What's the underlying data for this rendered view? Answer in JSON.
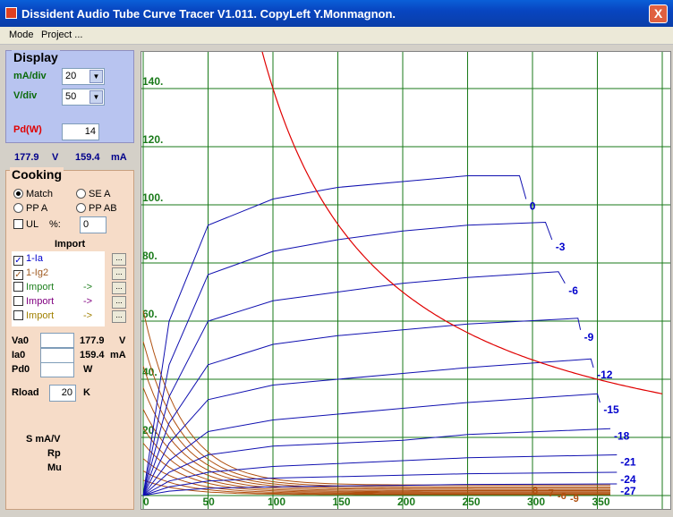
{
  "window": {
    "title": "Dissident Audio Tube Curve Tracer V1.011. CopyLeft Y.Monmagnon.",
    "close": "X"
  },
  "menu": [
    "Mode",
    "Project ..."
  ],
  "display": {
    "title": "Display",
    "ma_div_label": "mA/div",
    "ma_div_value": "20",
    "v_div_label": "V/div",
    "v_div_value": "50",
    "pd_label": "Pd(W)",
    "pd_value": "14"
  },
  "readout": {
    "voltage": "177.9",
    "voltage_unit": "V",
    "current": "159.4",
    "current_unit": "mA"
  },
  "cooking": {
    "title": "Cooking",
    "radios": [
      {
        "label": "Match",
        "checked": true
      },
      {
        "label": "SE A",
        "checked": false
      },
      {
        "label": "PP A",
        "checked": false
      },
      {
        "label": "PP AB",
        "checked": false
      }
    ],
    "ul_label": "UL",
    "ul_pct": "%:",
    "ul_value": "0",
    "import_title": "Import",
    "imports": [
      {
        "label": "1-Ia",
        "checked": true,
        "color": "#0000cc",
        "arrow": ""
      },
      {
        "label": "1-Ig2",
        "checked": true,
        "color": "#a05a20",
        "arrow": ""
      },
      {
        "label": "Import",
        "checked": false,
        "color": "#208020",
        "arrow": "->"
      },
      {
        "label": "Import",
        "checked": false,
        "color": "#800080",
        "arrow": "->"
      },
      {
        "label": "Import",
        "checked": false,
        "color": "#a08000",
        "arrow": "->"
      }
    ],
    "dots": "...",
    "va0_label": "Va0",
    "va0_value": "177.9",
    "va0_unit": "V",
    "ia0_label": "Ia0",
    "ia0_value": "159.4",
    "ia0_unit": "mA",
    "pd0_label": "Pd0",
    "pd0_value": "",
    "pd0_unit": "W",
    "rload_label": "Rload",
    "rload_value": "20",
    "rload_unit": "K",
    "s_label": "S mA/V",
    "rp_label": "Rp",
    "mu_label": "Mu"
  },
  "chart_data": {
    "type": "line",
    "xlabel": "",
    "ylabel": "",
    "xlim": [
      0,
      400
    ],
    "ylim": [
      0,
      160
    ],
    "x_ticks": [
      "0",
      "50",
      "100",
      "150",
      "200",
      "250",
      "300",
      "350"
    ],
    "y_ticks": [
      "20.",
      "40.",
      "60.",
      "80.",
      "100.",
      "120.",
      "140."
    ],
    "grid": true,
    "colors": {
      "plate": "#1010b0",
      "screen": "#b05010",
      "power": "#e00000",
      "grid": "#1a7a1a",
      "label": "#0000cc"
    },
    "series": [
      {
        "name": "0",
        "x": [
          0,
          20,
          50,
          100,
          150,
          200,
          250,
          290,
          295
        ],
        "y": [
          0,
          60,
          93,
          102,
          106,
          108,
          110,
          110,
          102
        ]
      },
      {
        "name": "-3",
        "x": [
          0,
          20,
          50,
          100,
          150,
          200,
          250,
          310,
          315
        ],
        "y": [
          0,
          45,
          76,
          84,
          88,
          91,
          93,
          94,
          88
        ]
      },
      {
        "name": "-6",
        "x": [
          0,
          20,
          50,
          100,
          150,
          200,
          250,
          320,
          325
        ],
        "y": [
          0,
          34,
          60,
          67,
          70,
          73,
          75,
          77,
          73
        ]
      },
      {
        "name": "-9",
        "x": [
          0,
          20,
          50,
          100,
          150,
          200,
          250,
          335,
          337
        ],
        "y": [
          0,
          25,
          45,
          52,
          55,
          57,
          59,
          61,
          57
        ]
      },
      {
        "name": "-12",
        "x": [
          0,
          20,
          50,
          100,
          150,
          200,
          250,
          345,
          347
        ],
        "y": [
          0,
          18,
          33,
          38,
          40,
          42,
          44,
          47,
          44
        ]
      },
      {
        "name": "-15",
        "x": [
          0,
          20,
          50,
          100,
          150,
          200,
          250,
          350,
          352
        ],
        "y": [
          0,
          12,
          22,
          26,
          28,
          30,
          32,
          35,
          32
        ]
      },
      {
        "name": "-18",
        "x": [
          0,
          20,
          50,
          100,
          150,
          200,
          250,
          360
        ],
        "y": [
          0,
          8,
          14,
          17,
          18,
          19,
          21,
          23
        ]
      },
      {
        "name": "-21",
        "x": [
          0,
          20,
          50,
          100,
          150,
          200,
          250,
          365
        ],
        "y": [
          0,
          5,
          8,
          10,
          11,
          12,
          13,
          14
        ]
      },
      {
        "name": "-24",
        "x": [
          0,
          20,
          50,
          100,
          150,
          200,
          250,
          365
        ],
        "y": [
          0,
          3,
          5,
          6,
          6.5,
          7,
          7.5,
          8
        ]
      },
      {
        "name": "-27",
        "x": [
          0,
          20,
          50,
          100,
          150,
          200,
          250,
          365
        ],
        "y": [
          0,
          1.5,
          2.5,
          3,
          3.3,
          3.5,
          3.8,
          4
        ]
      }
    ],
    "screen_series": [
      {
        "y0": 60
      },
      {
        "y0": 50
      },
      {
        "y0": 42
      },
      {
        "y0": 35
      },
      {
        "y0": 28
      },
      {
        "y0": 22
      },
      {
        "y0": 17
      },
      {
        "y0": 12
      },
      {
        "y0": 8
      },
      {
        "y0": 5
      }
    ],
    "screen_end_labels": [
      "8",
      "-7",
      "-6",
      "-9"
    ],
    "power_curve_watts": 14
  }
}
